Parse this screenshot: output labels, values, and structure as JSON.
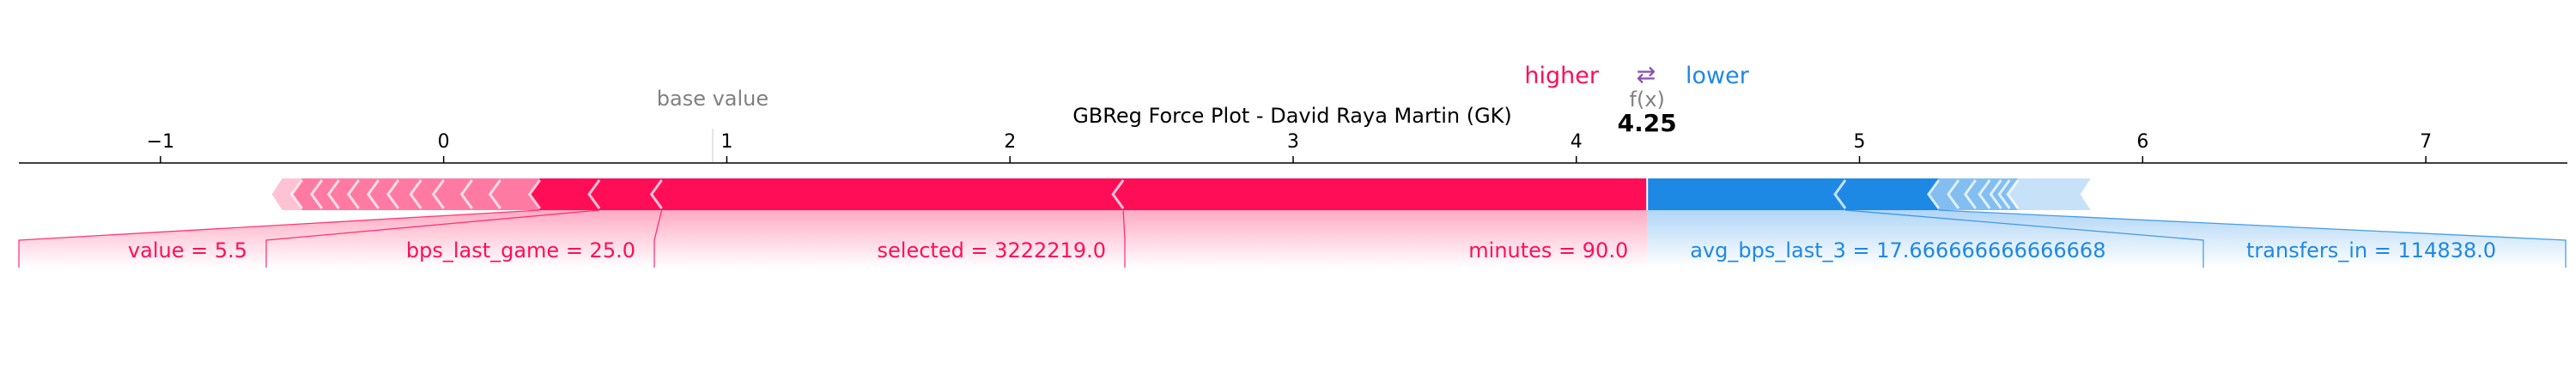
{
  "chart_data": {
    "type": "force",
    "title": "GBReg Force Plot - David Raya Martin (GK)",
    "base_value_label": "base value",
    "base_value": 0.95,
    "fx_label": "f(x)",
    "output_value": 4.25,
    "output_value_text": "4.25",
    "legend": {
      "higher": "higher",
      "arrow": "⇄",
      "lower": "lower"
    },
    "xlim": [
      -1.5,
      7.5
    ],
    "ticks": [
      -1,
      0,
      1,
      2,
      3,
      4,
      5,
      6,
      7
    ],
    "tick_labels": [
      "−1",
      "0",
      "1",
      "2",
      "3",
      "4",
      "5",
      "6",
      "7"
    ],
    "colors": {
      "positive": "#ff0d57",
      "negative": "#1e88e5"
    },
    "positive_features": [
      {
        "label": "minutes = 90.0",
        "start": 4.25,
        "end": 2.4
      },
      {
        "label": "selected = 3222219.0",
        "start": 2.4,
        "end": 0.77
      },
      {
        "label": "bps_last_game = 25.0",
        "start": 0.77,
        "end": 0.55
      },
      {
        "label": "value = 5.5",
        "start": 0.55,
        "end": 0.34
      }
    ],
    "positive_small_chevrons": [
      0.2,
      0.1,
      0.0,
      -0.08,
      -0.16,
      -0.23,
      -0.3,
      -0.37,
      -0.43,
      -0.5
    ],
    "positive_tail_end": -0.57,
    "negative_features": [
      {
        "label": "avg_bps_last_3 = 17.666666666666668",
        "start": 4.25,
        "end": 4.95
      },
      {
        "label": "transfers_in = 114838.0",
        "start": 4.95,
        "end": 5.28
      }
    ],
    "negative_small_chevrons": [
      5.35,
      5.41,
      5.46,
      5.5,
      5.53,
      5.56
    ],
    "negative_tail_end": 5.78
  }
}
